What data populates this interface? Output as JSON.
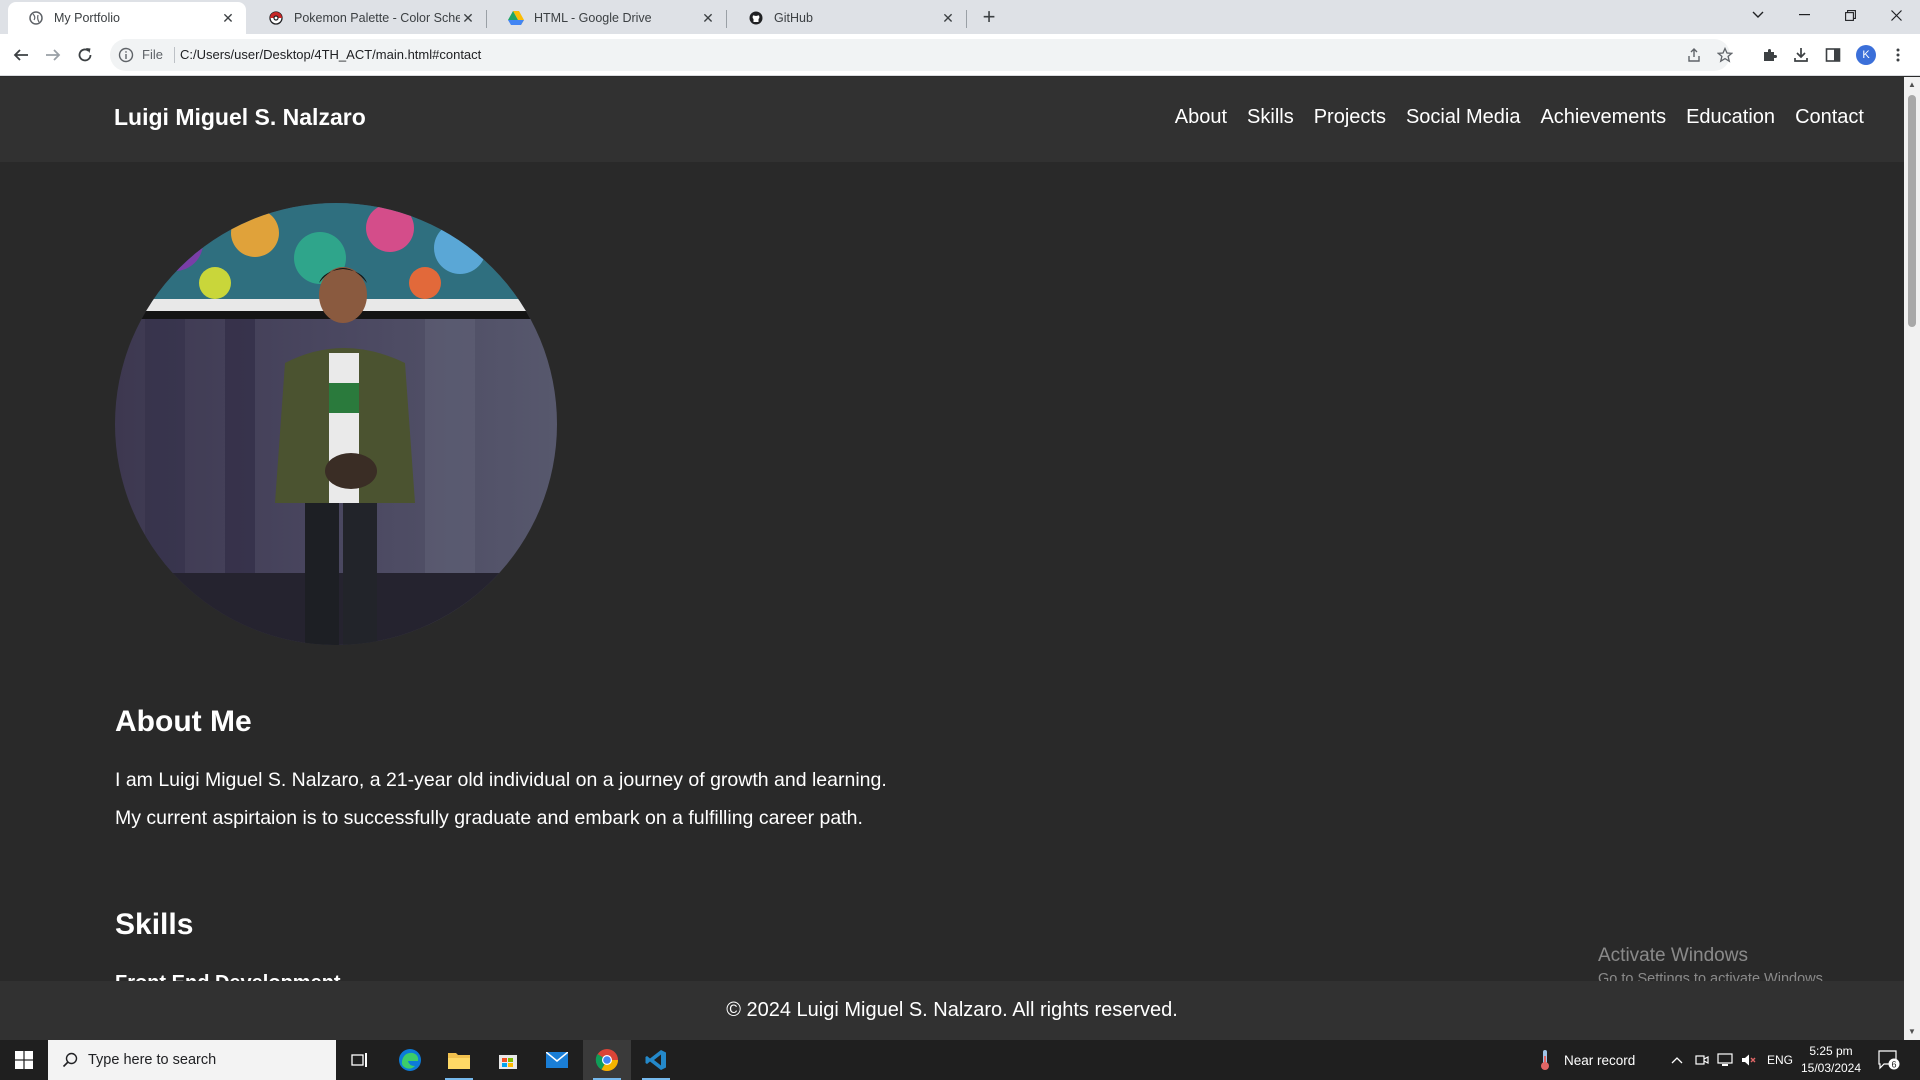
{
  "browser": {
    "tabs": [
      {
        "title": "My Portfolio",
        "icon": "globe-icon",
        "active": true
      },
      {
        "title": "Pokemon Palette - Color Scheme",
        "icon": "pokeball-icon",
        "active": false
      },
      {
        "title": "HTML - Google Drive",
        "icon": "google-drive-icon",
        "active": false
      },
      {
        "title": "GitHub",
        "icon": "github-icon",
        "active": false
      }
    ],
    "new_tab": "+",
    "address": {
      "scheme_label": "File",
      "url": "C:/Users/user/Desktop/4TH_ACT/main.html#contact"
    },
    "profile_initial": "K"
  },
  "site": {
    "name": "Luigi Miguel S. Nalzaro",
    "nav": [
      "About",
      "Skills",
      "Projects",
      "Social Media",
      "Achievements",
      "Education",
      "Contact"
    ],
    "about": {
      "title": "About Me",
      "lines": [
        "I am Luigi Miguel S. Nalzaro, a 21-year old individual on a journey of growth and learning.",
        "My current aspirtaion is to successfully graduate and embark on a fulfilling career path."
      ]
    },
    "skills": {
      "title": "Skills",
      "subtitle": "Front End Development"
    },
    "footer": "© 2024 Luigi Miguel S. Nalzaro. All rights reserved."
  },
  "watermark": {
    "title": "Activate Windows",
    "subtitle": "Go to Settings to activate Windows."
  },
  "taskbar": {
    "search_placeholder": "Type here to search",
    "apps": [
      "task-view-icon",
      "edge-icon",
      "file-explorer-icon",
      "microsoft-store-icon",
      "mail-icon",
      "chrome-icon",
      "vscode-icon"
    ],
    "weather": "Near record",
    "language": "ENG",
    "time": "5:25 pm",
    "date": "15/03/2024",
    "notifications": "6"
  },
  "colors": {
    "page_bg": "#292929",
    "header_bg": "#313131",
    "text": "#ffffff",
    "tab_strip": "#dee1e6",
    "taskbar": "#1f1f1f"
  }
}
